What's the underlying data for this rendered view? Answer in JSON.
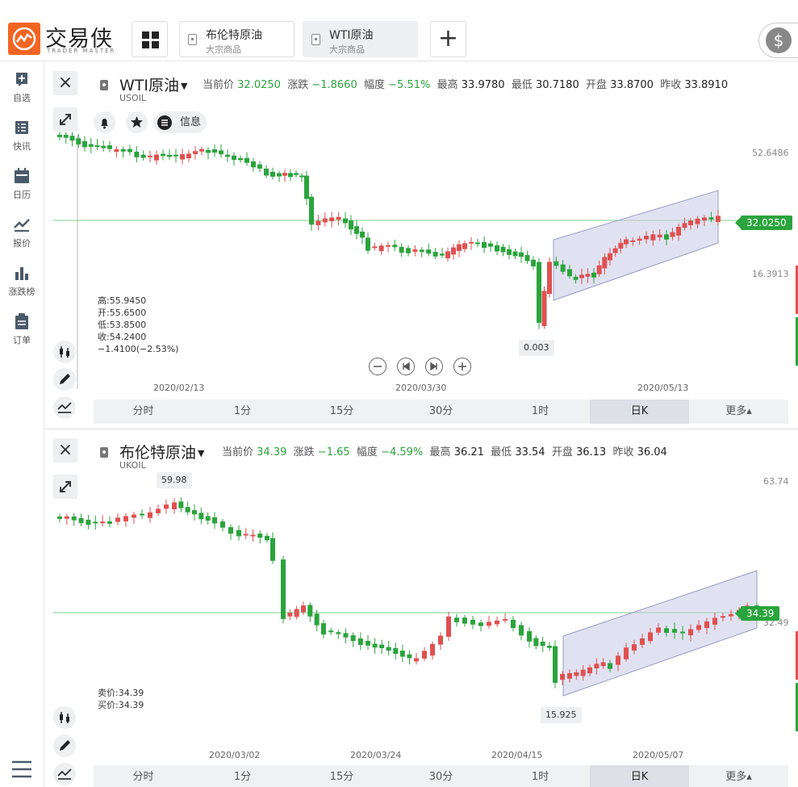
{
  "header": {
    "logo": {
      "name": "交易侠",
      "sub": "TRADER MASTER"
    },
    "tabs": [
      {
        "title": "布伦特原油",
        "subtitle": "大宗商品"
      },
      {
        "title": "WTI原油",
        "subtitle": "大宗商品"
      }
    ],
    "add_label": "+",
    "dollar_label": "$"
  },
  "sidebar": {
    "items": [
      {
        "label": "自选",
        "icon": "add-square-icon"
      },
      {
        "label": "快讯",
        "icon": "news-list-icon"
      },
      {
        "label": "日历",
        "icon": "calendar-icon"
      },
      {
        "label": "报价",
        "icon": "quote-trend-icon"
      },
      {
        "label": "涨跌榜",
        "icon": "bar-ranking-icon"
      },
      {
        "label": "订单",
        "icon": "order-clipboard-icon"
      }
    ],
    "bottom_icon": "menu-list-icon"
  },
  "panel1": {
    "name": "WTI原油",
    "code": "USOIL",
    "quote": {
      "current_label": "当前价",
      "current": "32.0250",
      "change_label": "涨跌",
      "change": "−1.8660",
      "pct_label": "幅度",
      "pct": "−5.51%",
      "high_label": "最高",
      "high": "33.9780",
      "low_label": "最低",
      "low": "30.7180",
      "open_label": "开盘",
      "open": "33.8700",
      "prev_label": "昨收",
      "prev": "33.8910"
    },
    "info_label": "信息",
    "ohlc": [
      "高:55.9450",
      "开:55.6500",
      "低:53.8500",
      "收:54.2400",
      "−1.4100(−2.53%)"
    ],
    "y_labels": [
      "52.6486",
      "16.3913"
    ],
    "x_labels": [
      "2020/02/13",
      "2020/03/30",
      "2020/05/13"
    ],
    "price_tag": "32.0250",
    "callout": "0.003",
    "periods": [
      "分时",
      "1分",
      "15分",
      "30分",
      "1时",
      "日K",
      "更多▴"
    ],
    "active_period": 5
  },
  "panel2": {
    "name": "布伦特原油",
    "code": "UKOIL",
    "quote": {
      "current_label": "当前价",
      "current": "34.39",
      "change_label": "涨跌",
      "change": "−1.65",
      "pct_label": "幅度",
      "pct": "−4.59%",
      "high_label": "最高",
      "high": "36.21",
      "low_label": "最低",
      "low": "33.54",
      "open_label": "开盘",
      "open": "36.13",
      "prev_label": "昨收",
      "prev": "36.04"
    },
    "bid_ask": [
      "卖价:34.39",
      "买价:34.39"
    ],
    "y_labels": [
      "63.74",
      "32.49"
    ],
    "x_labels": [
      "2020/03/02",
      "2020/03/24",
      "2020/04/15",
      "2020/05/07"
    ],
    "price_tag": "34.39",
    "callout_high": "59.98",
    "callout_low": "15.925",
    "periods": [
      "分时",
      "1分",
      "15分",
      "30分",
      "1时",
      "日K",
      "更多▴"
    ],
    "active_period": 5
  },
  "colors": {
    "up": "#e05050",
    "down": "#2aa43c",
    "brand": "#f26522",
    "channel": "#c9cbe6"
  }
}
